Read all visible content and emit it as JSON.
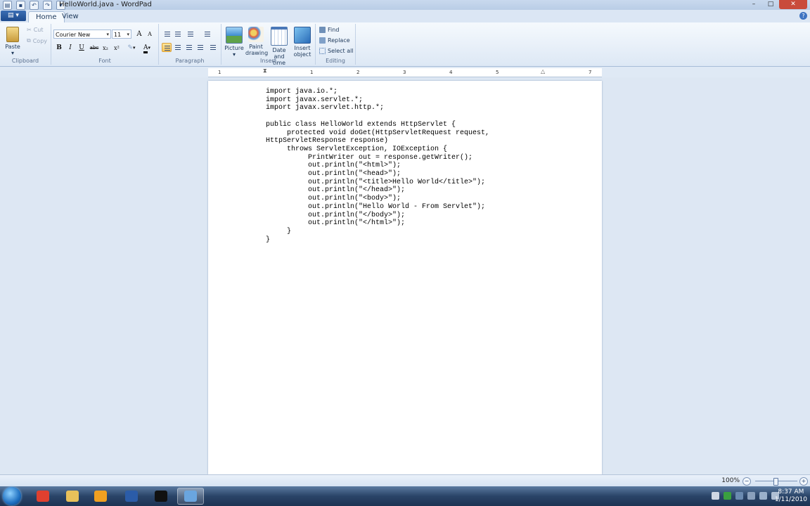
{
  "window": {
    "title": "HelloWorld.java - WordPad",
    "controls": {
      "minimize": "–",
      "maximize": "□",
      "close": "✕"
    }
  },
  "menu": {
    "app_button": "▤ ▾"
  },
  "tabs": [
    {
      "label": "Home",
      "active": true
    },
    {
      "label": "View",
      "active": false
    }
  ],
  "help": "?",
  "ribbon": {
    "clipboard": {
      "label": "Clipboard",
      "paste": "Paste",
      "cut": "Cut",
      "copy": "Copy"
    },
    "font": {
      "label": "Font",
      "family": "Courier New",
      "size": "11",
      "grow": "A",
      "shrink": "A",
      "bold": "B",
      "italic": "I",
      "underline": "U",
      "strike": "abc",
      "subscript": "x₂",
      "superscript": "x²",
      "color_letter": "A"
    },
    "paragraph": {
      "label": "Paragraph"
    },
    "insert": {
      "label": "Insert",
      "picture": "Picture",
      "paint_drawing_1": "Paint",
      "paint_drawing_2": "drawing",
      "date_time_1": "Date and",
      "date_time_2": "time",
      "insert_object_1": "Insert",
      "insert_object_2": "object"
    },
    "editing": {
      "label": "Editing",
      "find": "Find",
      "replace": "Replace",
      "select_all": "Select all"
    }
  },
  "ruler": {
    "numbers": [
      "1",
      "1",
      "2",
      "3",
      "4",
      "5",
      "6",
      "7"
    ]
  },
  "document": {
    "text": "import java.io.*;\nimport javax.servlet.*;\nimport javax.servlet.http.*;\n\npublic class HelloWorld extends HttpServlet {\n     protected void doGet(HttpServletRequest request,\nHttpServletResponse response)\n     throws ServletException, IOException {\n          PrintWriter out = response.getWriter();\n          out.println(\"<html>\");\n          out.println(\"<head>\");\n          out.println(\"<title>Hello World</title>\");\n          out.println(\"</head>\");\n          out.println(\"<body>\");\n          out.println(\"Hello World - From Servlet\");\n          out.println(\"</body>\");\n          out.println(\"</html>\");\n     }\n}"
  },
  "status": {
    "zoom": "100%",
    "zoom_out": "−",
    "zoom_in": "+",
    "zoom_level": 0.5
  },
  "taskbar": {
    "apps": [
      {
        "name": "chrome-icon",
        "color": "#e0402f"
      },
      {
        "name": "folder-icon",
        "color": "#e9c15a"
      },
      {
        "name": "media-player-icon",
        "color": "#f0a020"
      },
      {
        "name": "word-icon",
        "color": "#2b5ca8"
      },
      {
        "name": "cmd-icon",
        "color": "#111111"
      },
      {
        "name": "wordpad-icon",
        "color": "#6aa5df"
      }
    ],
    "time": "8:37 AM",
    "date": "1/11/2010"
  }
}
